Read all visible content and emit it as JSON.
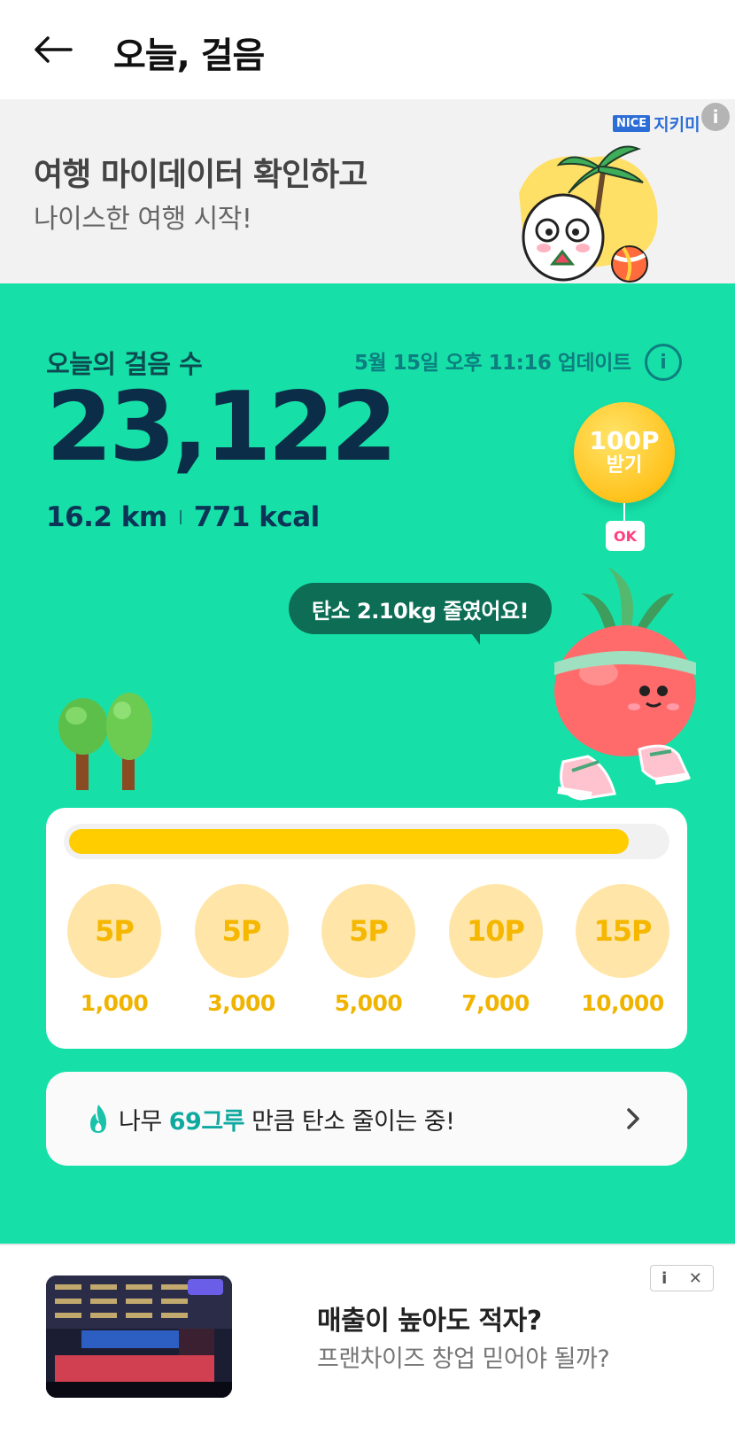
{
  "header": {
    "title": "오늘, 걸음"
  },
  "banner": {
    "title": "여행 마이데이터 확인하고",
    "subtitle": "나이스한 여행 시작!",
    "brand_box": "NICE",
    "brand_name": "지키미",
    "info": "i"
  },
  "steps": {
    "label": "오늘의 걸음 수",
    "updated": "5월 15일 오후 11:16 업데이트",
    "info": "i",
    "count": "23,122",
    "distance": "16.2 km",
    "calories": "771 kcal",
    "progress_fraction": 0.94
  },
  "reward": {
    "points": "100P",
    "action": "받기",
    "badge": "OK"
  },
  "speech": "탄소 2.10kg 줄였어요!",
  "milestones": [
    {
      "points": "5P",
      "steps": "1,000"
    },
    {
      "points": "5P",
      "steps": "3,000"
    },
    {
      "points": "5P",
      "steps": "5,000"
    },
    {
      "points": "10P",
      "steps": "7,000"
    },
    {
      "points": "15P",
      "steps": "10,000"
    }
  ],
  "carbon": {
    "prefix": "나무 ",
    "highlight": "69그루",
    "suffix": " 만큼 탄소 줄이는 중!"
  },
  "ad": {
    "title": "매출이 높아도 적자?",
    "subtitle": "프랜차이즈 창업 믿어야 될까?",
    "info": "i",
    "close": "✕"
  },
  "colors": {
    "main_bg": "#16e0a8",
    "progress": "#ffcd00",
    "highlight": "#10a9a0"
  }
}
